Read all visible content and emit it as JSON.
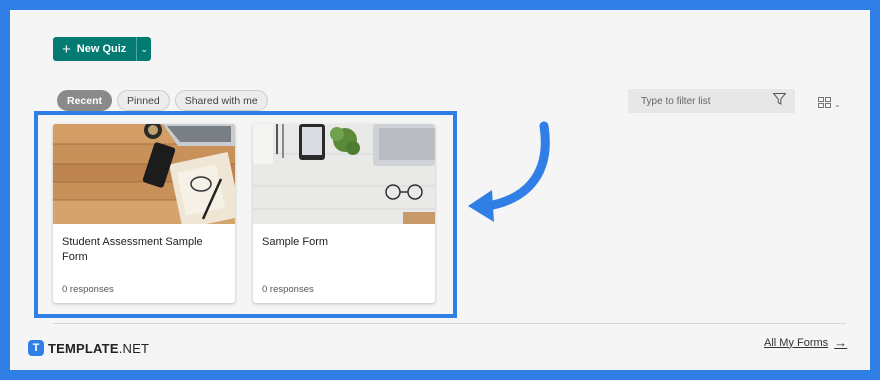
{
  "toolbar": {
    "new_quiz_label": "New Quiz",
    "plus_icon": "plus-icon",
    "caret_icon": "chevron-down-icon"
  },
  "tabs": [
    {
      "label": "Recent",
      "active": true
    },
    {
      "label": "Pinned",
      "active": false
    },
    {
      "label": "Shared with me",
      "active": false
    }
  ],
  "filter": {
    "placeholder": "Type to filter list",
    "icon": "filter-icon"
  },
  "view_toggle": {
    "icon": "grid-view-icon"
  },
  "forms": [
    {
      "title": "Student Assessment Sample Form",
      "responses": "0 responses",
      "image": "wooden-desk-with-phone-and-notebook"
    },
    {
      "title": "Sample Form",
      "responses": "0 responses",
      "image": "white-desk-with-plant-laptop-glasses"
    }
  ],
  "footer": {
    "all_forms_label": "All My Forms",
    "brand_bold": "TEMPLATE",
    "brand_rest": ".NET",
    "brand_badge": "T"
  },
  "colors": {
    "frame": "#2f7fe6",
    "primary": "#037b73",
    "panel": "#f5f5f5"
  }
}
